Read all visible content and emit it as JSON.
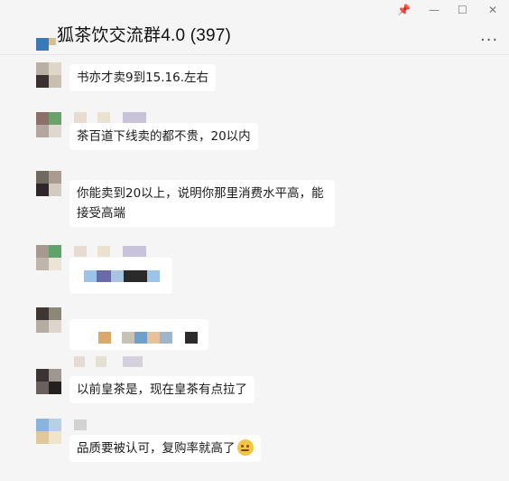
{
  "window": {
    "title": "狐茶饮交流群4.0 (397)",
    "controls": {
      "pin": "📌",
      "minimize": "—",
      "maximize": "☐",
      "close": "✕"
    },
    "more": "···"
  },
  "messages": [
    {
      "text": "书亦才卖9到15.16.左右"
    },
    {
      "text": "茶百道下线卖的都不贵，20以内"
    },
    {
      "text": "你能卖到20以上，说明你那里消费水平高，能接受高端"
    },
    {
      "text": ""
    },
    {
      "text": ""
    },
    {
      "text": "以前皇茶是，现在皇茶有点拉了"
    },
    {
      "text": "品质要被认可，复购率就高了",
      "emoji": "thinking-face"
    }
  ]
}
